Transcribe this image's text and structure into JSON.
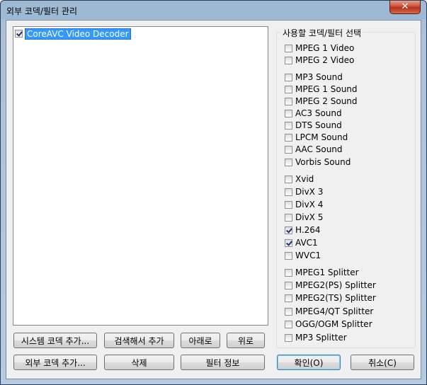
{
  "window": {
    "title": "외부 코덱/필터 관리",
    "close_glyph": "✕"
  },
  "filter_list": {
    "items": [
      {
        "label": "CoreAVC Video Decoder",
        "checked": true,
        "selected": true
      }
    ]
  },
  "codec_group": {
    "label": "사용할 코덱/필터 선택",
    "options": [
      {
        "label": "MPEG 1 Video",
        "checked": false
      },
      {
        "label": "MPEG 2 Video",
        "checked": false
      },
      {
        "label": "MP3 Sound",
        "checked": false
      },
      {
        "label": "MPEG 1 Sound",
        "checked": false
      },
      {
        "label": "MPEG 2 Sound",
        "checked": false
      },
      {
        "label": "AC3 Sound",
        "checked": false
      },
      {
        "label": "DTS Sound",
        "checked": false
      },
      {
        "label": "LPCM Sound",
        "checked": false
      },
      {
        "label": "AAC Sound",
        "checked": false
      },
      {
        "label": "Vorbis Sound",
        "checked": false
      },
      {
        "label": "Xvid",
        "checked": false
      },
      {
        "label": "DivX 3",
        "checked": false
      },
      {
        "label": "DivX 4",
        "checked": false
      },
      {
        "label": "DivX 5",
        "checked": false
      },
      {
        "label": "H.264",
        "checked": true
      },
      {
        "label": "AVC1",
        "checked": true
      },
      {
        "label": "WVC1",
        "checked": false
      },
      {
        "label": "MPEG1 Splitter",
        "checked": false
      },
      {
        "label": "MPEG2(PS) Splitter",
        "checked": false
      },
      {
        "label": "MPEG2(TS) Splitter",
        "checked": false
      },
      {
        "label": "MPEG4/QT Splitter",
        "checked": false
      },
      {
        "label": "OGG/OGM Splitter",
        "checked": false
      },
      {
        "label": "MP3 Splitter",
        "checked": false
      }
    ]
  },
  "buttons": {
    "add_system_codec": "시스템 코덱 추가...",
    "search_add": "검색해서 추가",
    "move_down": "아래로",
    "move_up": "위로",
    "add_external_codec": "외부 코덱  추가...",
    "delete": "삭제",
    "filter_info": "필터 정보",
    "ok": "확인(O)",
    "cancel": "취소(C)"
  }
}
